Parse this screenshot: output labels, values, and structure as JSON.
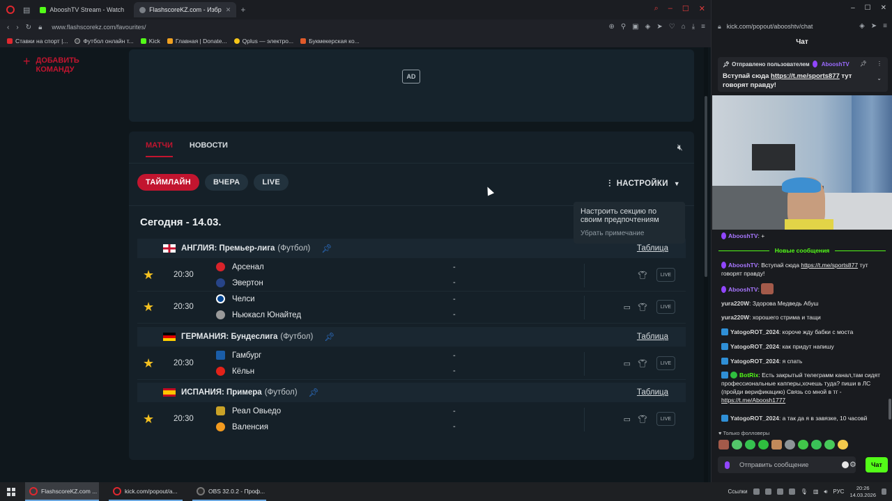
{
  "browser_left": {
    "tabs": [
      {
        "label": "AbooshTV Stream - Watch",
        "color": "#53fc18",
        "active": false
      },
      {
        "label": "FlashscoreKZ.com - Избр",
        "color": "#7a7f86",
        "active": true
      }
    ],
    "url": "www.flashscorekz.com/favourites/",
    "bookmarks": [
      {
        "label": "Ставки на спорт |...",
        "color": "#e0282f"
      },
      {
        "label": "Футбол онлайн т...",
        "color": "#3a3d42"
      },
      {
        "label": "Kick",
        "color": "#53fc18"
      },
      {
        "label": "Главная | Donate...",
        "color": "#f0a020"
      },
      {
        "label": "Qplus — электро...",
        "color": "#f5c518"
      },
      {
        "label": "Букмекерская ко...",
        "color": "#e05a2a"
      }
    ]
  },
  "sidebar": {
    "add_team_plus": "+",
    "add_team_label": "ДОБАВИТЬ КОМАНДУ"
  },
  "ad": {
    "label": "AD"
  },
  "content": {
    "tabs": [
      {
        "label": "МАТЧИ",
        "active": true
      },
      {
        "label": "НОВОСТИ",
        "active": false
      }
    ],
    "filters": [
      {
        "label": "ТАЙМЛАЙН",
        "active": true
      },
      {
        "label": "ВЧЕРА",
        "active": false
      },
      {
        "label": "LIVE",
        "active": false
      }
    ],
    "settings_label": "НАСТРОЙКИ",
    "tooltip": {
      "text": "Настроить секцию по своим предпочтениям",
      "dismiss": "Убрать примечание"
    },
    "date": "Сегодня - 14.03.",
    "table_link": "Таблица",
    "sport": "(Футбол)",
    "leagues": [
      {
        "name": "АНГЛИЯ: Премьер-лига",
        "matches": [
          {
            "time": "20:30",
            "home": "Арсенал",
            "away": "Эвертон",
            "home_score": "-",
            "away_score": "-",
            "home_crest": "#d8232a",
            "away_crest": "#274488",
            "tv": false
          },
          {
            "time": "20:30",
            "home": "Челси",
            "away": "Ньюкасл Юнайтед",
            "home_score": "-",
            "away_score": "-",
            "home_crest": "#034694",
            "away_crest": "#9a9a9a",
            "tv": true
          }
        ]
      },
      {
        "name": "ГЕРМАНИЯ: Бундеслига",
        "matches": [
          {
            "time": "20:30",
            "home": "Гамбург",
            "away": "Кёльн",
            "home_score": "-",
            "away_score": "-",
            "home_crest": "#1a5da8",
            "away_crest": "#e32219",
            "tv": true
          }
        ]
      },
      {
        "name": "ИСПАНИЯ: Примера",
        "matches": [
          {
            "time": "20:30",
            "home": "Реал Овьедо",
            "away": "Валенсия",
            "home_score": "-",
            "away_score": "-",
            "home_crest": "#c9a227",
            "away_crest": "#f29a1f",
            "tv": true
          }
        ]
      }
    ],
    "live_label": "LIVE",
    "star": "★"
  },
  "chat_window": {
    "url": "kick.com/popout/abooshtv/chat",
    "title": "Чат",
    "pinned": {
      "sent_by": "Отправлено пользователем",
      "user": "AbooshTV",
      "text_prefix": "Вступай сюда",
      "link": "https://t.me/sports877",
      "text_suffix": "тут говорят правду!"
    },
    "first_msg": {
      "user": "AbooshTV",
      "text": "+"
    },
    "new_messages_label": "Новые сообщения",
    "messages": [
      {
        "user": "AbooshTV",
        "text_prefix": "Вступай сюда",
        "link": "https://t.me/sports877",
        "text_suffix": "тут говорят правду!"
      },
      {
        "user": "AbooshTV",
        "text": ""
      },
      {
        "user": "yura220W",
        "text": "Здорова Медведь Абуш"
      },
      {
        "user": "yura220W",
        "text": "хорошего стрима и тащи"
      },
      {
        "user": "YatogoROT_2024",
        "text": "короче жду бабки с моста"
      },
      {
        "user": "YatogoROT_2024",
        "text": "как придут напишу"
      },
      {
        "user": "YatogoROT_2024",
        "text": "я спать"
      },
      {
        "user": "BotRix",
        "text": "Есть закрытый телеграмм канал,там сидят профессиональные капперы,хочешь туда? пиши в ЛС (пройди верификацию) Связь со мной в тг -",
        "link": "https://t.me/Aboosh1777"
      },
      {
        "user": "YatogoROT_2024",
        "text": "а так да я в завязке, 10 часовй"
      }
    ],
    "followers_label": "Только фолловеры",
    "input_placeholder": "Отправить сообщение",
    "send_label": "Чат"
  },
  "taskbar": {
    "items": [
      {
        "label": "FlashscoreKZ.com ..."
      },
      {
        "label": "kick.com/popout/a..."
      },
      {
        "label": "OBS 32.0.2 - Проф..."
      }
    ],
    "tray": {
      "links": "Ссылки",
      "lang": "РУС",
      "time": "20:26",
      "date": "14.03.2026"
    }
  }
}
